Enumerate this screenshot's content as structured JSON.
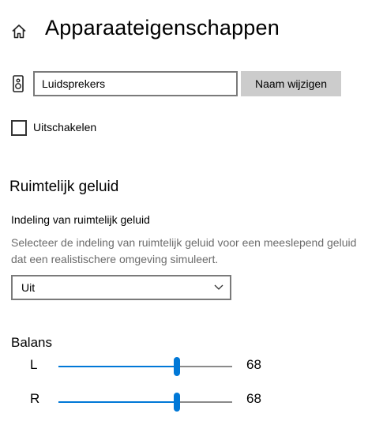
{
  "header": {
    "title": "Apparaateigenschappen",
    "home_icon": "home-icon"
  },
  "device": {
    "icon": "speaker-icon",
    "name_value": "Luidsprekers",
    "rename_label": "Naam wijzigen",
    "disable_label": "Uitschakelen",
    "disable_checked": false
  },
  "spatial": {
    "heading": "Ruimtelijk geluid",
    "format_label": "Indeling van ruimtelijk geluid",
    "description": "Selecteer de indeling van ruimtelijk geluid voor een meeslepend geluid dat een realistischere omgeving simuleert.",
    "selected": "Uit"
  },
  "balance": {
    "heading": "Balans",
    "channels": [
      {
        "label": "L",
        "value": "68",
        "level": 68
      },
      {
        "label": "R",
        "value": "68",
        "level": 68
      }
    ]
  },
  "colors": {
    "accent": "#0078d7",
    "button_bg": "#cccccc"
  }
}
